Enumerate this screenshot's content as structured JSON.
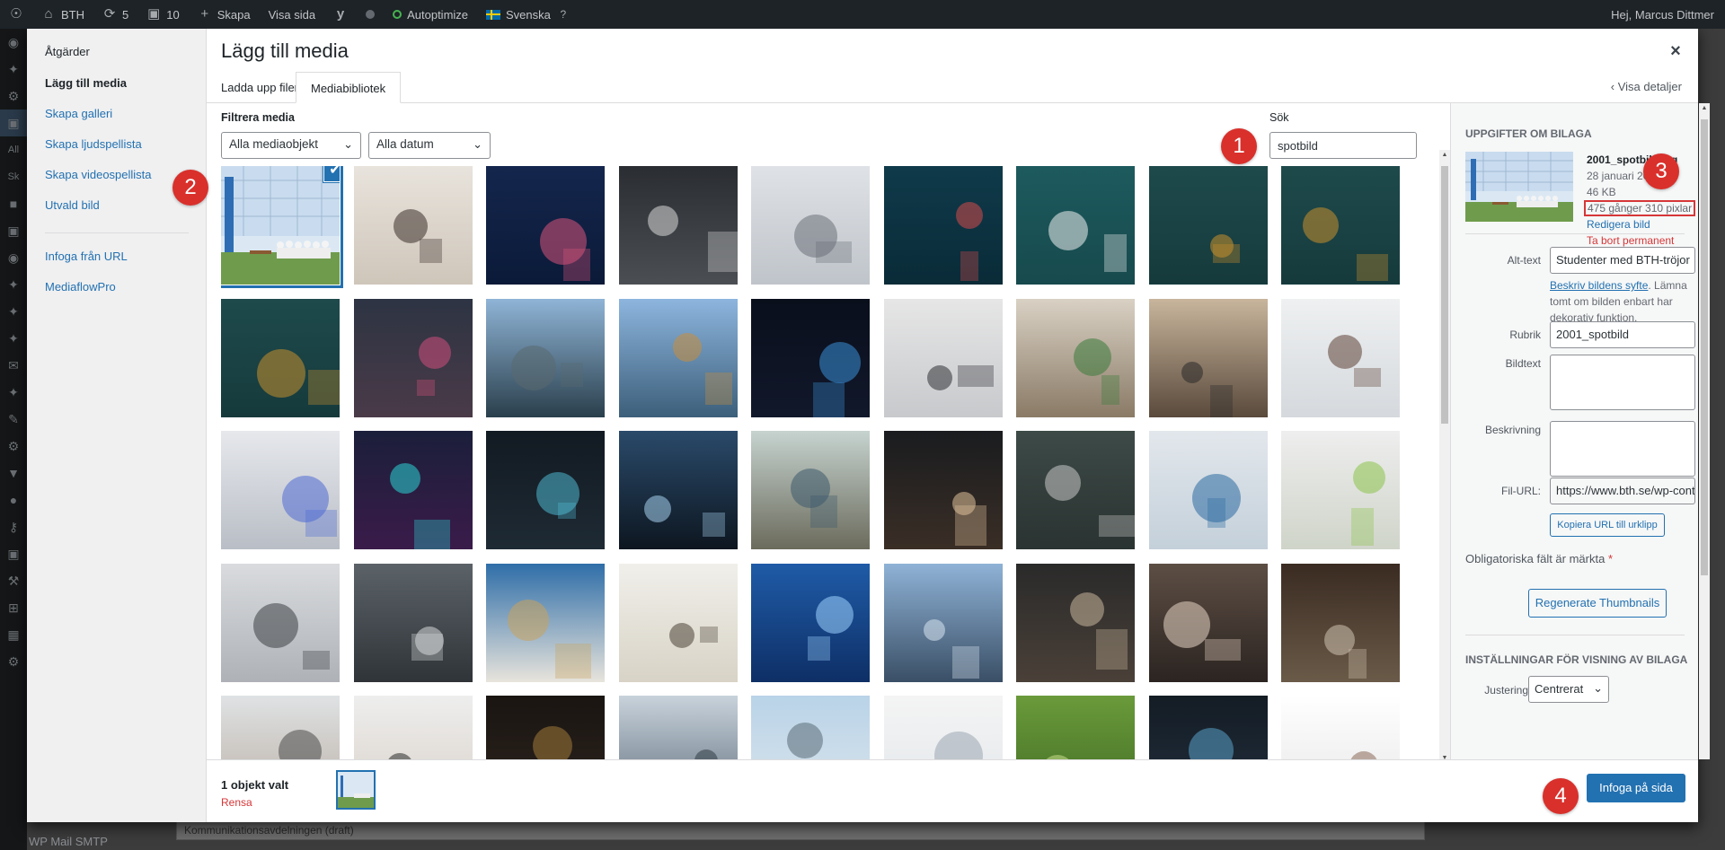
{
  "adminbar": {
    "site_name": "BTH",
    "updates_count": "5",
    "comments_count": "10",
    "new_label": "Skapa",
    "view_label": "Visa sida",
    "autoptimize_label": "Autoptimize",
    "language_label": "Svenska",
    "greeting": "Hej, Marcus Dittmer"
  },
  "background": {
    "footer_item": "WP Mail SMTP",
    "select_text": "Kommunikationsavdelningen (draft)",
    "sidebar_hint_1": "All",
    "sidebar_hint_2": "Sk"
  },
  "modal": {
    "title": "Lägg till media",
    "close": "×",
    "menu": {
      "heading": "Åtgärder",
      "items": [
        {
          "label": "Lägg till media"
        },
        {
          "label": "Skapa galleri"
        },
        {
          "label": "Skapa ljudspellista"
        },
        {
          "label": "Skapa videospellista"
        },
        {
          "label": "Utvald bild"
        }
      ],
      "items_after_sep": [
        {
          "label": "Infoga från URL"
        },
        {
          "label": "MediaflowPro"
        }
      ]
    },
    "tabs": [
      {
        "label": "Ladda upp filer"
      },
      {
        "label": "Mediabibliotek"
      }
    ],
    "view_details": "Visa detaljer",
    "filter": {
      "label": "Filtrera media",
      "type_select": "Alla mediaobjekt",
      "date_select": "Alla datum"
    },
    "search": {
      "label": "Sök",
      "value": "spotbild"
    },
    "details": {
      "heading": "UPPGIFTER OM BILAGA",
      "filename": "2001_spotbild.jpg",
      "date": "28 januari 2022",
      "size": "46 KB",
      "dimensions": "475 gånger 310 pixlar",
      "edit_link": "Redigera bild",
      "delete_link": "Ta bort permanent",
      "alt_label": "Alt-text",
      "alt_value": "Studenter med BTH-tröjor",
      "alt_help_link": "Beskriv bildens syfte",
      "alt_help_text": ". Lämna tomt om bilden enbart har dekorativ funktion.",
      "title_label": "Rubrik",
      "title_value": "2001_spotbild",
      "caption_label": "Bildtext",
      "description_label": "Beskrivning",
      "url_label": "Fil-URL:",
      "url_value": "https://www.bth.se/wp-content/",
      "copy_url": "Kopiera URL till urklipp",
      "required_note": "Obligatoriska fält är märkta",
      "required_star": "*",
      "regenerate": "Regenerate Thumbnails",
      "display_heading": "INSTÄLLNINGAR FÖR VISNING AV BILAGA",
      "align_label": "Justering",
      "align_value": "Centrerat"
    },
    "toolbar": {
      "selection_count": "1 objekt valt",
      "clear": "Rensa",
      "insert": "Infoga på sida"
    }
  },
  "badges": [
    "1",
    "2",
    "3",
    "4"
  ],
  "grid": [
    {
      "top": "#e9f1f8",
      "bottom": "#6e9b4d",
      "accent": "#2e6db4"
    },
    {
      "top": "#e8e3dc",
      "bottom": "#cfc6ba",
      "accent": "#3a2f2a"
    },
    {
      "top": "#14264d",
      "bottom": "#0b1a38",
      "accent": "#d9547a"
    },
    {
      "top": "#2a2d31",
      "bottom": "#4b4f54",
      "accent": "#d8d8d8"
    },
    {
      "top": "#dfe2e6",
      "bottom": "#bfc4ca",
      "accent": "#6b7078"
    },
    {
      "top": "#0f3a4a",
      "bottom": "#0a2b38",
      "accent": "#d64a4a"
    },
    {
      "top": "#1d5a5e",
      "bottom": "#174a4d",
      "accent": "#f1f1f1"
    },
    {
      "top": "#1e4a4c",
      "bottom": "#163a3c",
      "accent": "#c9902c"
    },
    {
      "top": "#1e4a4c",
      "bottom": "#163a3c",
      "accent": "#c9902c"
    },
    {
      "top": "#1e4a4c",
      "bottom": "#163a3c",
      "accent": "#c9902c"
    },
    {
      "top": "#2d3443",
      "bottom": "#4a3a48",
      "accent": "#d04f7b"
    },
    {
      "top": "#8fb4d6",
      "bottom": "#2a3f4c",
      "accent": "#5a6a70"
    },
    {
      "top": "#8db5de",
      "bottom": "#3c5f7a",
      "accent": "#c98e3c"
    },
    {
      "top": "#0a0f1c",
      "bottom": "#11182a",
      "accent": "#3a8fd8"
    },
    {
      "top": "#e6e6e6",
      "bottom": "#c7c9cc",
      "accent": "#2d2f33"
    },
    {
      "top": "#d9d1c4",
      "bottom": "#8a7a66",
      "accent": "#3a7a3a"
    },
    {
      "top": "#c8b59c",
      "bottom": "#5a4a3c",
      "accent": "#2a2a2a"
    },
    {
      "top": "#eef0f1",
      "bottom": "#d5d9dd",
      "accent": "#5c4035"
    },
    {
      "top": "#e6e8ec",
      "bottom": "#b9bec6",
      "accent": "#4e6ad4"
    },
    {
      "top": "#1b1f3a",
      "bottom": "#3a1b4a",
      "accent": "#2ad3d3"
    },
    {
      "top": "#121a22",
      "bottom": "#1e2a34",
      "accent": "#4fb8d0"
    },
    {
      "top": "#2a4a6a",
      "bottom": "#0d1620",
      "accent": "#a6d2ee"
    },
    {
      "top": "#c6d3cf",
      "bottom": "#6b6b5c",
      "accent": "#3d5a6c"
    },
    {
      "top": "#1a1c1f",
      "bottom": "#3a2e26",
      "accent": "#e0c19a"
    },
    {
      "top": "#3d4a47",
      "bottom": "#2a3331",
      "accent": "#c8c8c8"
    },
    {
      "top": "#e2e7ec",
      "bottom": "#c4d0da",
      "accent": "#2a6aa0"
    },
    {
      "top": "#eeeeee",
      "bottom": "#cfd4c9",
      "accent": "#8bc34a"
    },
    {
      "top": "#d9dbde",
      "bottom": "#aeb2b7",
      "accent": "#3c3f44"
    },
    {
      "top": "#5b6268",
      "bottom": "#2f3438",
      "accent": "#d7d9da"
    },
    {
      "top": "#2f6ea8",
      "bottom": "#e8e4dc",
      "accent": "#c9a25c"
    },
    {
      "top": "#f0efea",
      "bottom": "#d8d3c6",
      "accent": "#4a4236"
    },
    {
      "top": "#1f5ba7",
      "bottom": "#0e2f66",
      "accent": "#9fd4ff"
    },
    {
      "top": "#8fb2d6",
      "bottom": "#3a4f66",
      "accent": "#d9e6f0"
    },
    {
      "top": "#2a2a2a",
      "bottom": "#4a4038",
      "accent": "#c9b79c"
    },
    {
      "top": "#5d4e44",
      "bottom": "#2b2421",
      "accent": "#e8d5c4"
    },
    {
      "top": "#3a2b22",
      "bottom": "#6a5a48",
      "accent": "#d0c2b0"
    },
    {
      "top": "#dfe2e4",
      "bottom": "#b8aca0",
      "accent": "#4a4a4a"
    },
    {
      "top": "#eeeeee",
      "bottom": "#d8cfc5",
      "accent": "#2a2a2a"
    },
    {
      "top": "#1a1512",
      "bottom": "#2d241d",
      "accent": "#a07a3a"
    },
    {
      "top": "#c8d2db",
      "bottom": "#5a6a78",
      "accent": "#303a44"
    },
    {
      "top": "#b9d3e8",
      "bottom": "#dde6ec",
      "accent": "#5a6a74"
    },
    {
      "top": "#f4f4f4",
      "bottom": "#e1e6ea",
      "accent": "#9aa6b0"
    },
    {
      "top": "#6a9a3a",
      "bottom": "#3e6a24",
      "accent": "#c9df8a"
    },
    {
      "top": "#141c24",
      "bottom": "#223040",
      "accent": "#5aa0c8"
    },
    {
      "top": "#ffffff",
      "bottom": "#e5e5e5",
      "accent": "#8a6a5a"
    }
  ],
  "colors": {
    "accent": "#2271b1",
    "danger": "#d63638",
    "badge": "#d9302c"
  }
}
